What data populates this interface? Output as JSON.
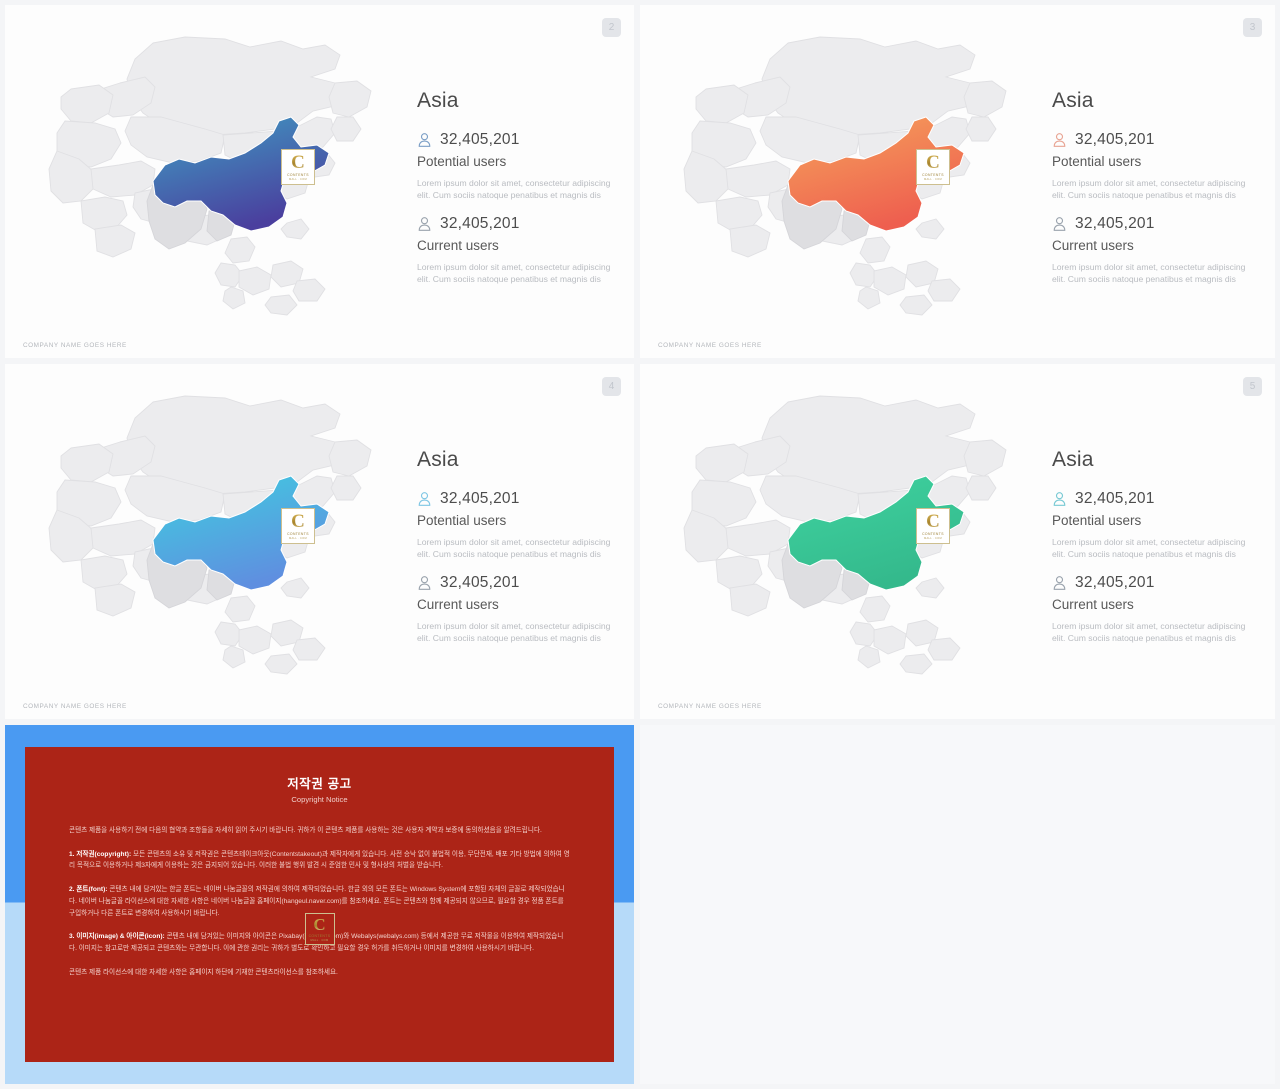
{
  "page": {
    "background": "#f4f5f7",
    "slide_count": 5
  },
  "logo": {
    "letter": "C",
    "line1": "CONTENTS",
    "line2": "MALL . COM",
    "border_color": "#cdbf8f"
  },
  "common": {
    "region_title": "Asia",
    "potential": {
      "value": "32,405,201",
      "label": "Potential users",
      "desc": "Lorem ipsum dolor sit amet, consectetur adipiscing elit. Cum sociis natoque penatibus et magnis dis"
    },
    "current": {
      "value": "32,405,201",
      "label": "Current users",
      "desc": "Lorem ipsum dolor sit amet, consectetur adipiscing elit. Cum sociis natoque penatibus et magnis dis"
    },
    "footer": "COMPANY NAME GOES HERE",
    "person_icon": "person-icon",
    "map_name": "asia-map",
    "highlight_country": "china"
  },
  "slides": [
    {
      "number": "2",
      "accent": "#4b8fc7",
      "china_gradient_from": "#3f9fc4",
      "china_gradient_to": "#4a3f9e",
      "icon_color": "#7c9fc6"
    },
    {
      "number": "3",
      "accent": "#ef7a55",
      "china_gradient_from": "#f6a45c",
      "china_gradient_to": "#ee5f4f",
      "icon_color": "#e8a493"
    },
    {
      "number": "4",
      "accent": "#42b6e0",
      "china_gradient_from": "#3ecfe0",
      "china_gradient_to": "#5f8fe0",
      "icon_color": "#7fc6e4"
    },
    {
      "number": "5",
      "accent": "#34c08f",
      "china_gradient_from": "#3fd3a0",
      "china_gradient_to": "#34b98c",
      "icon_color": "#78c9d4"
    }
  ],
  "copyright": {
    "number": "",
    "title": "저작권 공고",
    "subtitle": "Copyright Notice",
    "frame_top_color": "#4a9af2",
    "frame_bottom_color": "#b6daf9",
    "panel_color": "#ac2417",
    "paragraphs": [
      {
        "lead": "",
        "text": "콘텐츠 제품을 사용하기 전에 다음의 협약과 조항들을 자세히 읽어 주시기 바랍니다. 귀하가 이 콘텐츠 제품를 사용하는 것은 사용자 계약과 보증에 동의하셨음을 알려드립니다."
      },
      {
        "lead": "1. 저작권(copyright):",
        "text": "모든 콘텐츠의 소유 및 저작권은 콘텐츠테이크아웃(Contentstakeout)과 제작자에게 있습니다. 사전 승낙 없이 불법적 이용, 무단전재, 배포 기타 방법에 의하여 영리 목적으로 이용하거나 제3자에게 이용하는 것은 금지되어 있습니다. 이러한 불법 행위 발견 시 준엄한 민사 및 형사상의 처벌을 받습니다."
      },
      {
        "lead": "2. 폰트(font):",
        "text": "콘텐츠 내에 담겨있는 한글 폰트는 네이버 나눔글꼴의 저작권에 의하여 제작되었습니다. 한글 외의 모든 폰트는 Windows System에 포함된 자체의 글꼴로 제작되었습니다. 네이버 나눔글꼴 라이선스에 대한 자세한 사항은 네이버 나눔글꼴 홈페이지(hangeul.naver.com)를 참조하세요. 폰트는 콘텐츠와 함께 제공되지 않으므로, 필요할 경우 정품 폰트를 구입하거나 다른 폰트로 변경하여 사용하시기 바랍니다."
      },
      {
        "lead": "3. 이미지(image) & 아이콘(icon):",
        "text": "콘텐츠 내에 담겨있는 이미지와 아이콘은 Pixabay(pixabay.com)와 Webalys(webalys.com) 등에서 제공한 무료 저작물을 이용하여 제작되었습니다. 이미지는 참고로만 제공되고 콘텐츠와는 무관합니다. 이에 관한 권리는 귀하가 별도로 확인하고 필요할 경우 허가를 취득하거나 이미지를 변경하여 사용하시기 바랍니다."
      },
      {
        "lead": "",
        "text": "콘텐츠 제품 라이선스에 대한 자세한 사항은 홈페이지 하단에 기재한 콘텐츠라이선스를 참조하세요."
      }
    ]
  }
}
